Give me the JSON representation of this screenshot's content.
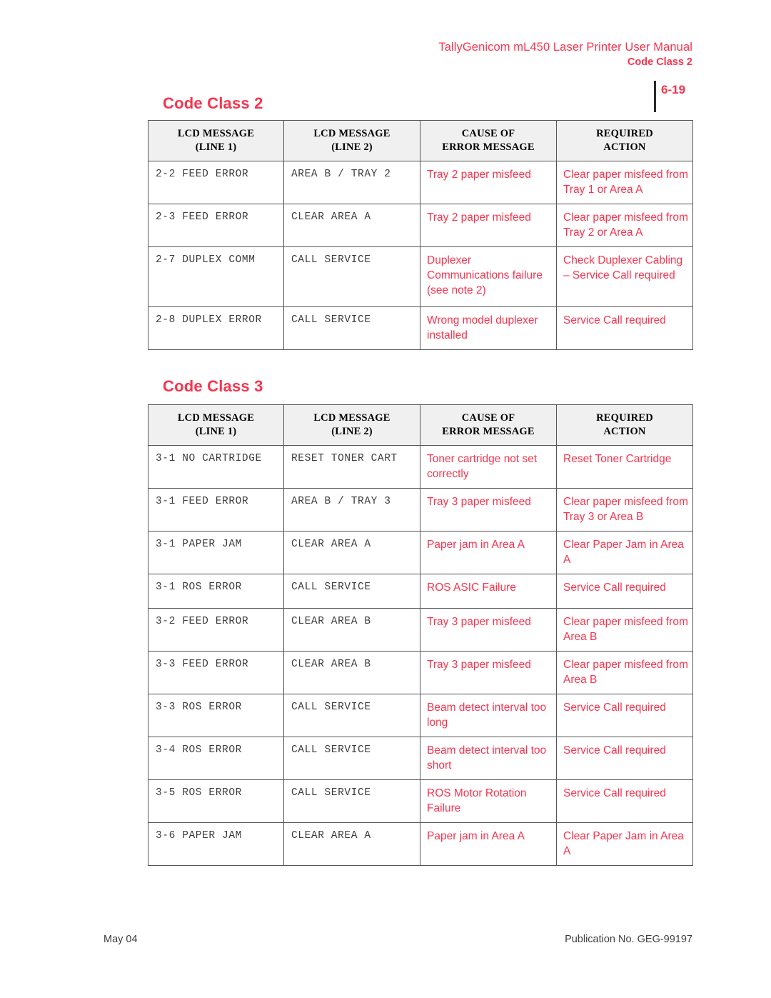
{
  "header": {
    "manual_title": "TallyGenicom mL450 Laser Printer User Manual",
    "section_label": "Code Class 2",
    "page_number": "6-19"
  },
  "footer": {
    "date": "May 04",
    "publication": "Publication No. GEG-99197"
  },
  "columns": {
    "lcd_line1_top": "LCD MESSAGE",
    "lcd_line1_bottom": "(LINE 1)",
    "lcd_line2_top": "LCD MESSAGE",
    "lcd_line2_bottom": "(LINE 2)",
    "cause_top": "CAUSE OF",
    "cause_bottom": "ERROR MESSAGE",
    "action_top": "REQUIRED",
    "action_bottom": "ACTION"
  },
  "sections": [
    {
      "heading": "Code Class 2",
      "rows": [
        {
          "line1": "2-2 FEED ERROR",
          "line2": "AREA B / TRAY 2",
          "cause": "Tray 2 paper misfeed",
          "action": "Clear paper misfeed from Tray 1 or Area A"
        },
        {
          "line1": "2-3 FEED ERROR",
          "line2": "CLEAR AREA A",
          "cause": "Tray 2 paper misfeed",
          "action": "Clear paper misfeed from Tray 2 or Area A"
        },
        {
          "line1": "2-7 DUPLEX COMM",
          "line2": "CALL SERVICE",
          "cause": "Duplexer Communications failure (see note 2)",
          "action": "Check Duplexer Cabling – Service Call required"
        },
        {
          "line1": "2-8 DUPLEX ERROR",
          "line2": "CALL SERVICE",
          "cause": "Wrong model duplexer installed",
          "action": "Service Call required"
        }
      ]
    },
    {
      "heading": "Code Class 3",
      "rows": [
        {
          "line1": "3-1 NO CARTRIDGE",
          "line2": "RESET TONER CART",
          "cause": "Toner cartridge not set correctly",
          "action": "Reset Toner Cartridge"
        },
        {
          "line1": "3-1 FEED ERROR",
          "line2": "AREA B / TRAY 3",
          "cause": "Tray 3 paper misfeed",
          "action": "Clear paper misfeed from Tray 3 or Area B"
        },
        {
          "line1": "3-1 PAPER JAM",
          "line2": "CLEAR AREA A",
          "cause": "Paper jam in Area A",
          "action": "Clear Paper Jam in Area A"
        },
        {
          "line1": "3-1 ROS ERROR",
          "line2": "CALL SERVICE",
          "cause": "ROS ASIC Failure",
          "action": "Service Call required"
        },
        {
          "line1": "3-2 FEED ERROR",
          "line2": "CLEAR AREA B",
          "cause": "Tray 3 paper misfeed",
          "action": "Clear paper misfeed from Area B"
        },
        {
          "line1": "3-3 FEED ERROR",
          "line2": "CLEAR AREA B",
          "cause": "Tray 3 paper misfeed",
          "action": "Clear paper misfeed from Area B"
        },
        {
          "line1": "3-3 ROS ERROR",
          "line2": "CALL SERVICE",
          "cause": "Beam detect interval too long",
          "action": "Service Call required"
        },
        {
          "line1": "3-4 ROS ERROR",
          "line2": "CALL SERVICE",
          "cause": "Beam detect interval too short",
          "action": "Service Call required"
        },
        {
          "line1": "3-5 ROS ERROR",
          "line2": "CALL SERVICE",
          "cause": "ROS Motor Rotation Failure",
          "action": "Service Call required"
        },
        {
          "line1": "3-6 PAPER JAM",
          "line2": "CLEAR AREA A",
          "cause": "Paper jam in Area A",
          "action": "Clear Paper Jam in Area A"
        }
      ]
    }
  ],
  "colors": {
    "accent_red": "#f8344e",
    "mono_text": "#3d3d3d",
    "header_fill": "#f0f0f0",
    "border": "#555555"
  }
}
